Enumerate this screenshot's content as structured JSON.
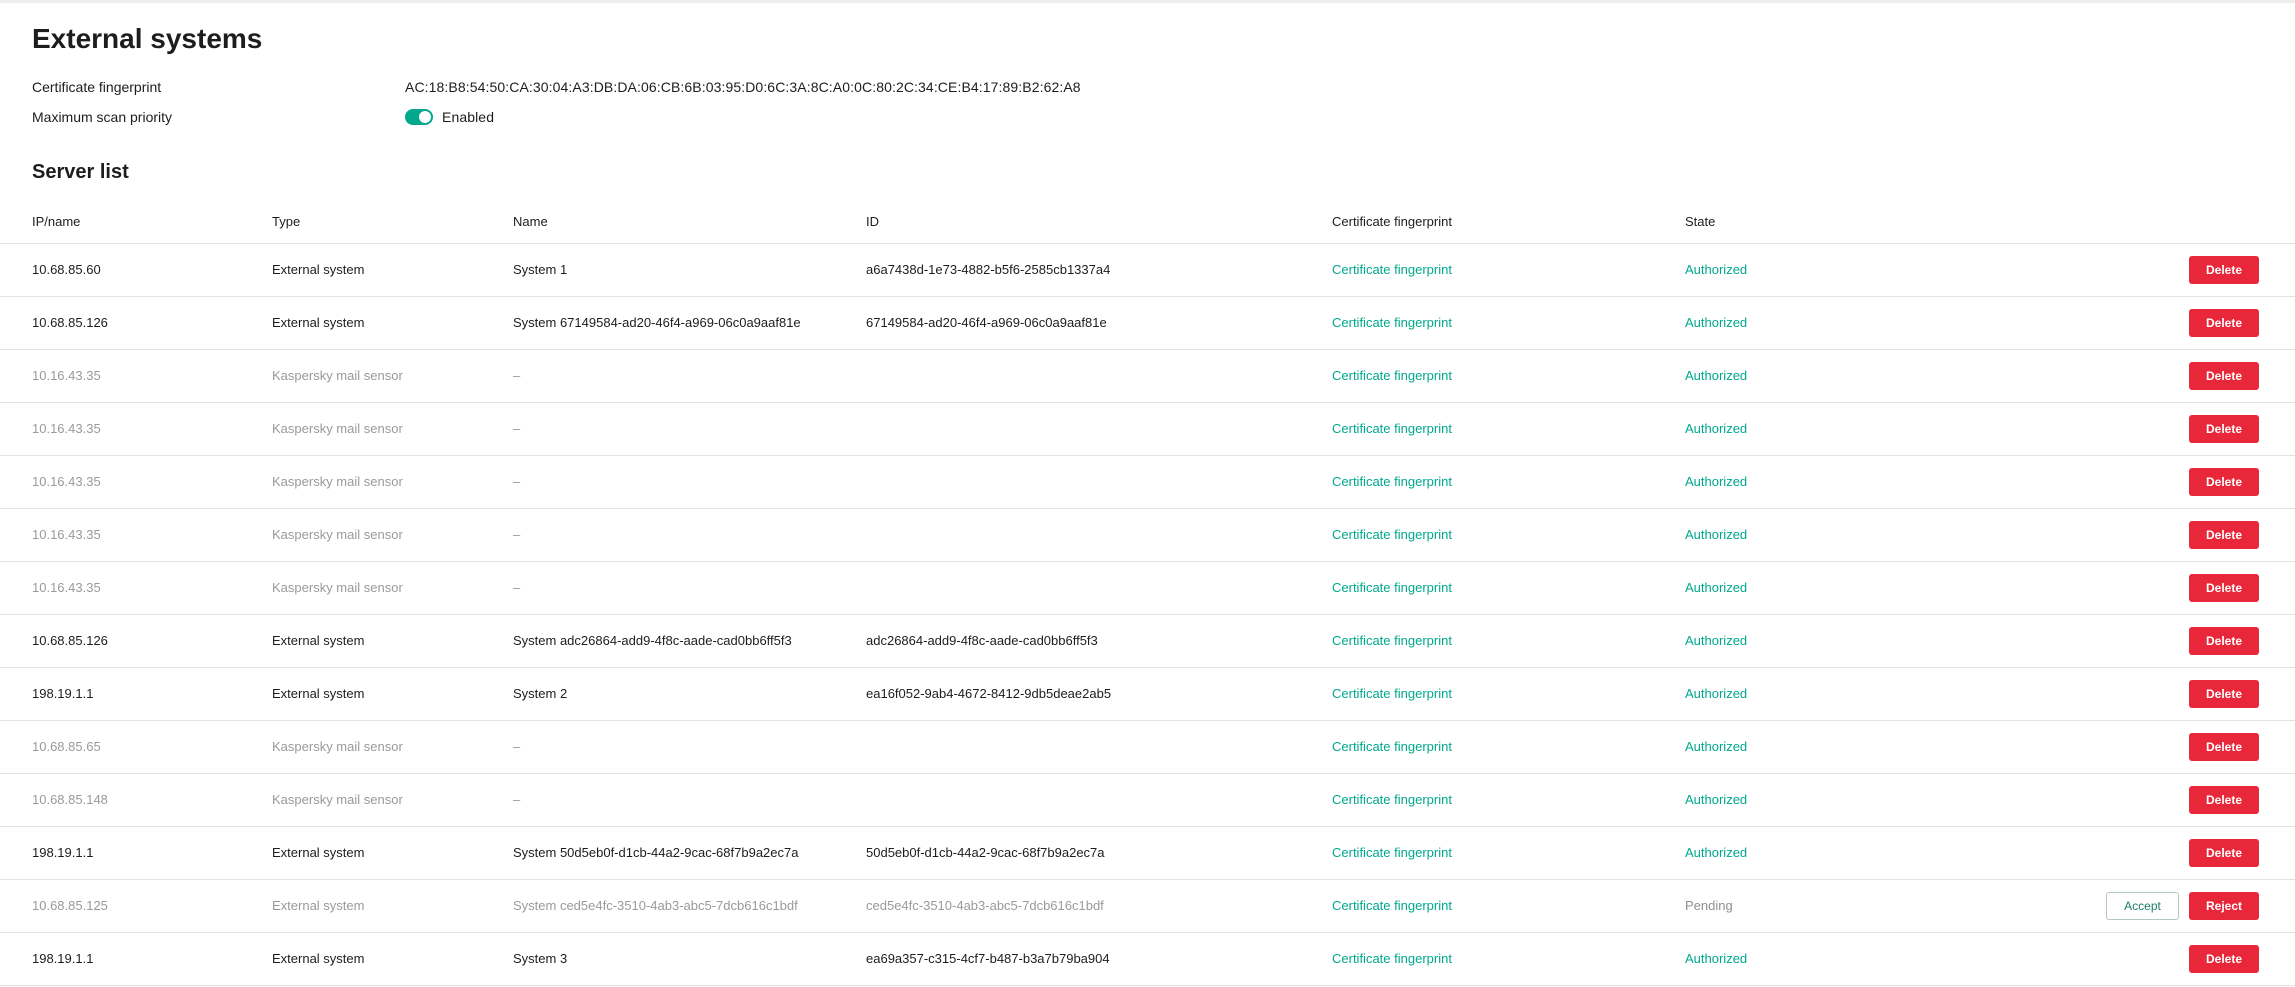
{
  "page": {
    "title": "External systems",
    "section_title": "Server list"
  },
  "settings": {
    "fingerprint_label": "Certificate fingerprint",
    "fingerprint_value": "AC:18:B8:54:50:CA:30:04:A3:DB:DA:06:CB:6B:03:95:D0:6C:3A:8C:A0:0C:80:2C:34:CE:B4:17:89:B2:62:A8",
    "priority_label": "Maximum scan priority",
    "priority_value": "Enabled",
    "priority_enabled": true
  },
  "colors": {
    "accent": "#00a88e",
    "danger": "#e8283a",
    "muted_text": "#9a9a9a"
  },
  "table": {
    "headers": {
      "ip": "IP/name",
      "type": "Type",
      "name": "Name",
      "id": "ID",
      "fingerprint": "Certificate fingerprint",
      "state": "State"
    },
    "rows": [
      {
        "ip": "10.68.85.60",
        "type": "External system",
        "name": "System 1",
        "id": "a6a7438d-1e73-4882-b5f6-2585cb1337a4",
        "fingerprint": "Certificate fingerprint",
        "state": "Authorized",
        "actions": [
          "Delete"
        ],
        "muted": false
      },
      {
        "ip": "10.68.85.126",
        "type": "External system",
        "name": "System 67149584-ad20-46f4-a969-06c0a9aaf81e",
        "id": "67149584-ad20-46f4-a969-06c0a9aaf81e",
        "fingerprint": "Certificate fingerprint",
        "state": "Authorized",
        "actions": [
          "Delete"
        ],
        "muted": false
      },
      {
        "ip": "10.16.43.35",
        "type": "Kaspersky mail sensor",
        "name": "–",
        "id": "",
        "fingerprint": "Certificate fingerprint",
        "state": "Authorized",
        "actions": [
          "Delete"
        ],
        "muted": true
      },
      {
        "ip": "10.16.43.35",
        "type": "Kaspersky mail sensor",
        "name": "–",
        "id": "",
        "fingerprint": "Certificate fingerprint",
        "state": "Authorized",
        "actions": [
          "Delete"
        ],
        "muted": true
      },
      {
        "ip": "10.16.43.35",
        "type": "Kaspersky mail sensor",
        "name": "–",
        "id": "",
        "fingerprint": "Certificate fingerprint",
        "state": "Authorized",
        "actions": [
          "Delete"
        ],
        "muted": true
      },
      {
        "ip": "10.16.43.35",
        "type": "Kaspersky mail sensor",
        "name": "–",
        "id": "",
        "fingerprint": "Certificate fingerprint",
        "state": "Authorized",
        "actions": [
          "Delete"
        ],
        "muted": true
      },
      {
        "ip": "10.16.43.35",
        "type": "Kaspersky mail sensor",
        "name": "–",
        "id": "",
        "fingerprint": "Certificate fingerprint",
        "state": "Authorized",
        "actions": [
          "Delete"
        ],
        "muted": true
      },
      {
        "ip": "10.68.85.126",
        "type": "External system",
        "name": "System adc26864-add9-4f8c-aade-cad0bb6ff5f3",
        "id": "adc26864-add9-4f8c-aade-cad0bb6ff5f3",
        "fingerprint": "Certificate fingerprint",
        "state": "Authorized",
        "actions": [
          "Delete"
        ],
        "muted": false
      },
      {
        "ip": "198.19.1.1",
        "type": "External system",
        "name": "System 2",
        "id": "ea16f052-9ab4-4672-8412-9db5deae2ab5",
        "fingerprint": "Certificate fingerprint",
        "state": "Authorized",
        "actions": [
          "Delete"
        ],
        "muted": false
      },
      {
        "ip": "10.68.85.65",
        "type": "Kaspersky mail sensor",
        "name": "–",
        "id": "",
        "fingerprint": "Certificate fingerprint",
        "state": "Authorized",
        "actions": [
          "Delete"
        ],
        "muted": true
      },
      {
        "ip": "10.68.85.148",
        "type": "Kaspersky mail sensor",
        "name": "–",
        "id": "",
        "fingerprint": "Certificate fingerprint",
        "state": "Authorized",
        "actions": [
          "Delete"
        ],
        "muted": true
      },
      {
        "ip": "198.19.1.1",
        "type": "External system",
        "name": "System 50d5eb0f-d1cb-44a2-9cac-68f7b9a2ec7a",
        "id": "50d5eb0f-d1cb-44a2-9cac-68f7b9a2ec7a",
        "fingerprint": "Certificate fingerprint",
        "state": "Authorized",
        "actions": [
          "Delete"
        ],
        "muted": false
      },
      {
        "ip": "10.68.85.125",
        "type": "External system",
        "name": "System ced5e4fc-3510-4ab3-abc5-7dcb616c1bdf",
        "id": "ced5e4fc-3510-4ab3-abc5-7dcb616c1bdf",
        "fingerprint": "Certificate fingerprint",
        "state": "Pending",
        "actions": [
          "Accept",
          "Reject"
        ],
        "muted": true
      },
      {
        "ip": "198.19.1.1",
        "type": "External system",
        "name": "System 3",
        "id": "ea69a357-c315-4cf7-b487-b3a7b79ba904",
        "fingerprint": "Certificate fingerprint",
        "state": "Authorized",
        "actions": [
          "Delete"
        ],
        "muted": false
      }
    ]
  }
}
